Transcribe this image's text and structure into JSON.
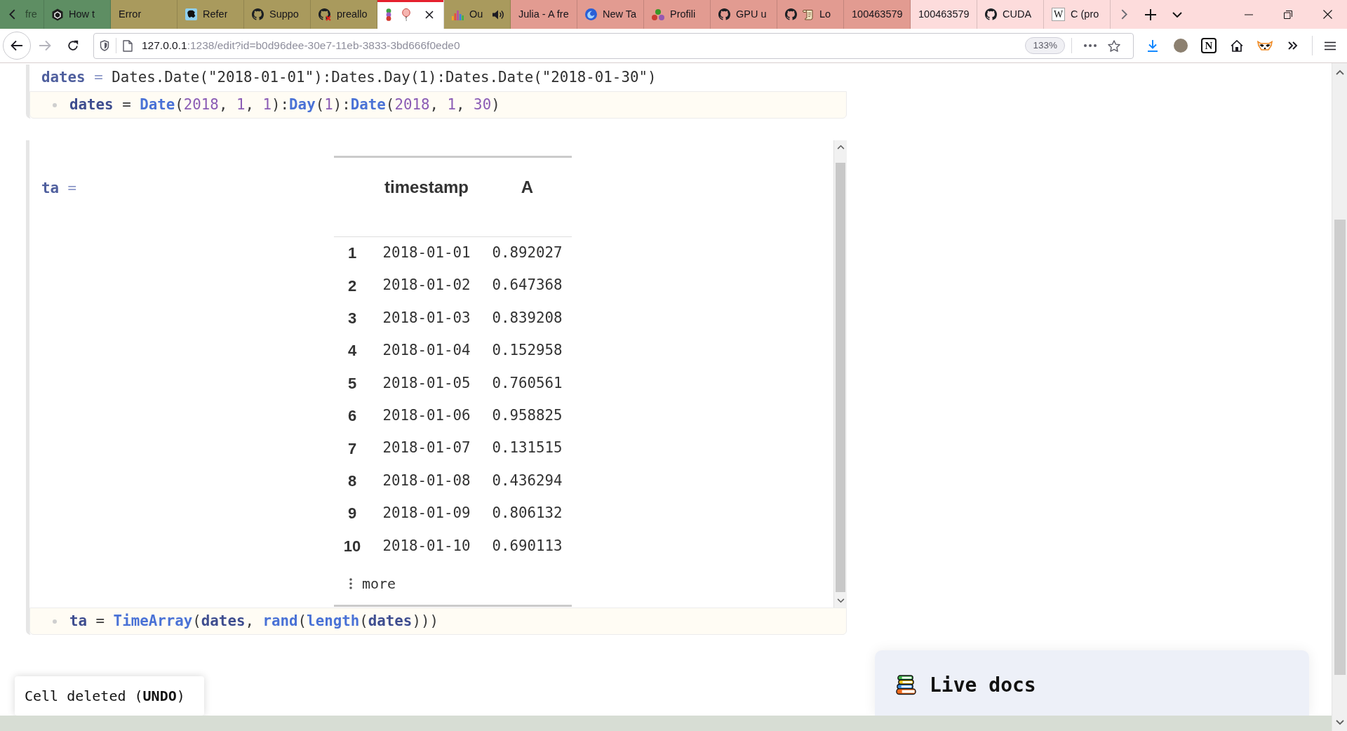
{
  "browser": {
    "tabs": [
      {
        "title": "fre",
        "color": "#5e8e63",
        "selected": false,
        "playing": false
      },
      {
        "title": "How t",
        "color": "#5e8e63",
        "selected": false,
        "playing": false
      },
      {
        "title": "Error",
        "color": "#a99a5d",
        "selected": false,
        "playing": false
      },
      {
        "title": "Refer",
        "color": "#a99a5d",
        "selected": false,
        "playing": false
      },
      {
        "title": "Suppo",
        "color": "#a99a5d",
        "selected": false,
        "playing": false
      },
      {
        "title": "preallo",
        "color": "#a99a5d",
        "selected": false,
        "playing": false
      },
      {
        "color": "#ffffff",
        "selected": true,
        "playing": false
      },
      {
        "title": "Ou",
        "color": "#a99a5d",
        "selected": false,
        "playing": true
      },
      {
        "title": "Julia - A fre",
        "color": "#e29b91",
        "selected": false,
        "playing": false
      },
      {
        "title": "New Ta",
        "color": "#e29b91",
        "selected": false,
        "playing": false
      },
      {
        "title": "Profili",
        "color": "#e29b91",
        "selected": false,
        "playing": false
      },
      {
        "title": "GPU u",
        "color": "#e29b91",
        "selected": false,
        "playing": false
      },
      {
        "title": "Lo",
        "color": "#e29b91",
        "selected": false,
        "playing": false
      },
      {
        "title": "100463579",
        "color": "#e29b91",
        "selected": false,
        "playing": false
      },
      {
        "title": "100463579",
        "color": "#fddcdc",
        "selected": false,
        "playing": false
      },
      {
        "title": "CUDA",
        "color": "#fddcdc",
        "selected": false,
        "playing": false
      },
      {
        "title": "C (pro",
        "color": "#fddcdc",
        "selected": false,
        "playing": false,
        "favicon_letter": "W"
      }
    ],
    "forward_disabled": true,
    "url": {
      "host": "127.0.0.1",
      "path": ":1238/edit?id=b0d96dee-30e7-11eb-3833-3bd666f0ede0"
    },
    "zoom": "133%",
    "extension_letter": "N"
  },
  "cells": [
    {
      "output": {
        "variable": "dates",
        "sign": "=",
        "value": "Dates.Date(\"2018-01-01\"):Dates.Day(1):Dates.Date(\"2018-01-30\")"
      },
      "code": [
        {
          "text": "dates",
          "kind": "var"
        },
        {
          "text": " = ",
          "kind": "op"
        },
        {
          "text": "Date",
          "kind": "func"
        },
        {
          "text": "(",
          "kind": "punct"
        },
        {
          "text": "2018",
          "kind": "num"
        },
        {
          "text": ", ",
          "kind": "punct"
        },
        {
          "text": "1",
          "kind": "num"
        },
        {
          "text": ", ",
          "kind": "punct"
        },
        {
          "text": "1",
          "kind": "num"
        },
        {
          "text": "):",
          "kind": "punct"
        },
        {
          "text": "Day",
          "kind": "func"
        },
        {
          "text": "(",
          "kind": "punct"
        },
        {
          "text": "1",
          "kind": "num"
        },
        {
          "text": "):",
          "kind": "punct"
        },
        {
          "text": "Date",
          "kind": "func"
        },
        {
          "text": "(",
          "kind": "punct"
        },
        {
          "text": "2018",
          "kind": "num"
        },
        {
          "text": ", ",
          "kind": "punct"
        },
        {
          "text": "1",
          "kind": "num"
        },
        {
          "text": ", ",
          "kind": "punct"
        },
        {
          "text": "30",
          "kind": "num"
        },
        {
          "text": ")",
          "kind": "punct"
        }
      ]
    },
    {
      "output": {
        "variable": "ta",
        "sign": "=",
        "table": {
          "columns": [
            "timestamp",
            "A"
          ],
          "rows": [
            {
              "index": "1",
              "cells": [
                "2018-01-01",
                "0.892027"
              ]
            },
            {
              "index": "2",
              "cells": [
                "2018-01-02",
                "0.647368"
              ]
            },
            {
              "index": "3",
              "cells": [
                "2018-01-03",
                "0.839208"
              ]
            },
            {
              "index": "4",
              "cells": [
                "2018-01-04",
                "0.152958"
              ]
            },
            {
              "index": "5",
              "cells": [
                "2018-01-05",
                "0.760561"
              ]
            },
            {
              "index": "6",
              "cells": [
                "2018-01-06",
                "0.958825"
              ]
            },
            {
              "index": "7",
              "cells": [
                "2018-01-07",
                "0.131515"
              ]
            },
            {
              "index": "8",
              "cells": [
                "2018-01-08",
                "0.436294"
              ]
            },
            {
              "index": "9",
              "cells": [
                "2018-01-09",
                "0.806132"
              ]
            },
            {
              "index": "10",
              "cells": [
                "2018-01-10",
                "0.690113"
              ]
            }
          ],
          "more": "more"
        }
      },
      "code": [
        {
          "text": "ta",
          "kind": "var"
        },
        {
          "text": " = ",
          "kind": "op"
        },
        {
          "text": "TimeArray",
          "kind": "func"
        },
        {
          "text": "(",
          "kind": "punct"
        },
        {
          "text": "dates",
          "kind": "var"
        },
        {
          "text": ", ",
          "kind": "punct"
        },
        {
          "text": "rand",
          "kind": "func"
        },
        {
          "text": "(",
          "kind": "punct"
        },
        {
          "text": "length",
          "kind": "func"
        },
        {
          "text": "(",
          "kind": "punct"
        },
        {
          "text": "dates",
          "kind": "var"
        },
        {
          "text": ")))",
          "kind": "punct"
        }
      ]
    }
  ],
  "toast": {
    "before": "Cell deleted (",
    "link": "UNDO",
    "after": ")"
  },
  "live_docs": {
    "title": "Live docs"
  }
}
